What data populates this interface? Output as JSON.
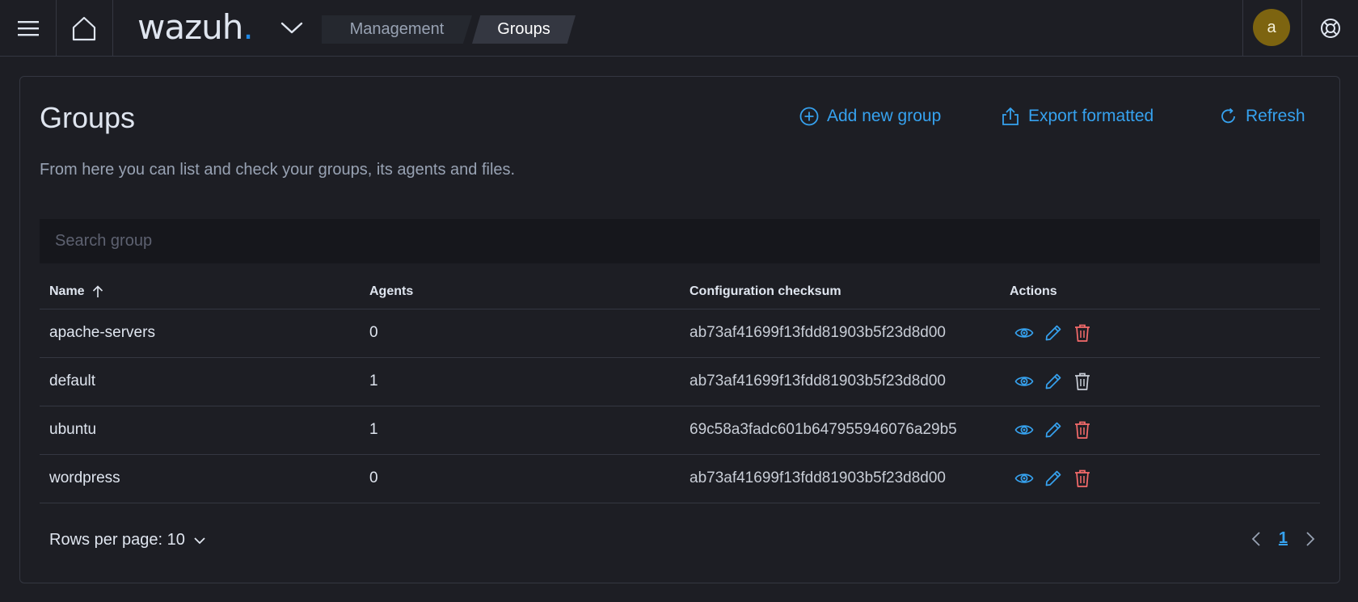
{
  "header": {
    "logo_text": "wazuh",
    "logo_dot": ".",
    "breadcrumbs": [
      "Management",
      "Groups"
    ],
    "user_initial": "a"
  },
  "page": {
    "title": "Groups",
    "description": "From here you can list and check your groups, its agents and files.",
    "actions": {
      "add": "Add new group",
      "export": "Export formatted",
      "refresh": "Refresh"
    },
    "search": {
      "placeholder": "Search group",
      "value": ""
    }
  },
  "table": {
    "columns": [
      "Name",
      "Agents",
      "Configuration checksum",
      "Actions"
    ],
    "sort": {
      "column": "Name",
      "direction": "asc"
    },
    "rows": [
      {
        "name": "apache-servers",
        "agents": "0",
        "checksum": "ab73af41699f13fdd81903b5f23d8d00",
        "delete_enabled": true
      },
      {
        "name": "default",
        "agents": "1",
        "checksum": "ab73af41699f13fdd81903b5f23d8d00",
        "delete_enabled": false
      },
      {
        "name": "ubuntu",
        "agents": "1",
        "checksum": "69c58a3fadc601b647955946076a29b5",
        "delete_enabled": true
      },
      {
        "name": "wordpress",
        "agents": "0",
        "checksum": "ab73af41699f13fdd81903b5f23d8d00",
        "delete_enabled": true
      }
    ]
  },
  "footer": {
    "rows_per_page": "Rows per page: 10",
    "current_page": "1"
  },
  "colors": {
    "accent": "#36a2ef",
    "danger": "#f66b6b",
    "disabled": "#c8cdd6",
    "background": "#1d1e24"
  }
}
